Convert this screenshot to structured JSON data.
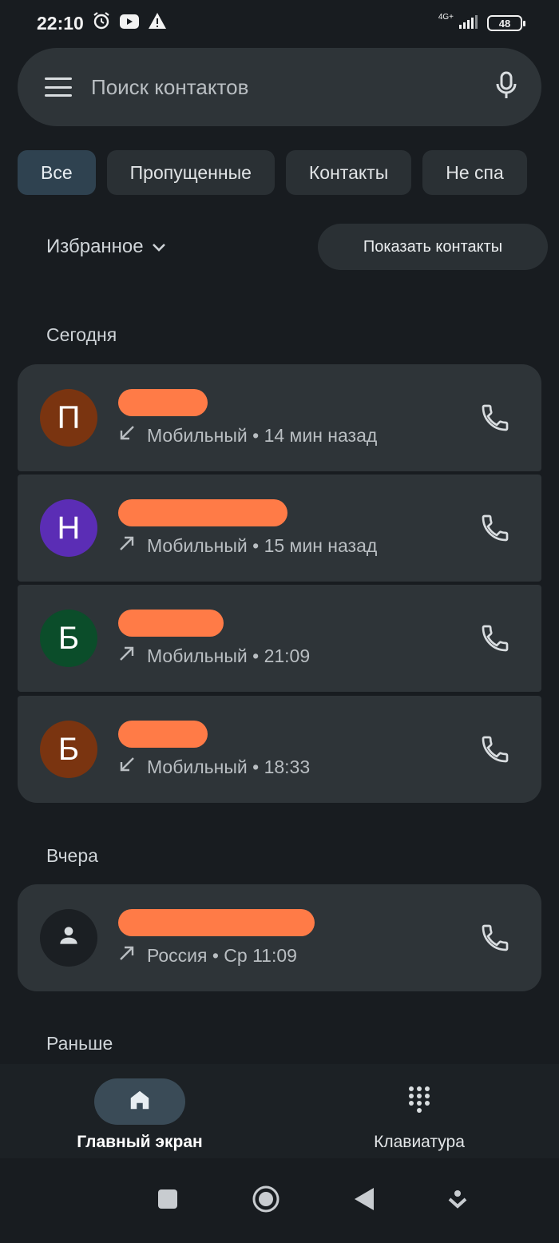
{
  "status_bar": {
    "time": "22:10",
    "network": "4G+",
    "battery": "48"
  },
  "search": {
    "placeholder": "Поиск контактов"
  },
  "filters": [
    {
      "label": "Все",
      "active": true
    },
    {
      "label": "Пропущенные",
      "active": false
    },
    {
      "label": "Контакты",
      "active": false
    },
    {
      "label": "Не спа",
      "active": false
    }
  ],
  "favorites": {
    "label": "Избранное",
    "show_contacts_label": "Показать контакты"
  },
  "sections": {
    "today": "Сегодня",
    "yesterday": "Вчера",
    "earlier": "Раньше"
  },
  "calls": [
    {
      "initial": "П",
      "avatar_color": "#7a3410",
      "direction": "incoming",
      "type": "Мобильный",
      "time": "14 мин назад"
    },
    {
      "initial": "Н",
      "avatar_color": "#5b2db5",
      "direction": "outgoing",
      "type": "Мобильный",
      "time": "15 мин назад"
    },
    {
      "initial": "Б",
      "avatar_color": "#0b4d2a",
      "direction": "outgoing",
      "type": "Мобильный",
      "time": "21:09"
    },
    {
      "initial": "Б",
      "avatar_color": "#7a3410",
      "direction": "incoming",
      "type": "Мобильный",
      "time": "18:33"
    },
    {
      "initial": "",
      "avatar_color": "#1b1f23",
      "direction": "outgoing",
      "type": "Россия",
      "time": "Ср 11:09"
    }
  ],
  "bottom_nav": {
    "home_label": "Главный экран",
    "keypad_label": "Клавиатура"
  },
  "colors": {
    "background": "#181c20",
    "card": "#2e3438",
    "redaction": "#ff7b47",
    "active_chip": "#2f4250"
  }
}
